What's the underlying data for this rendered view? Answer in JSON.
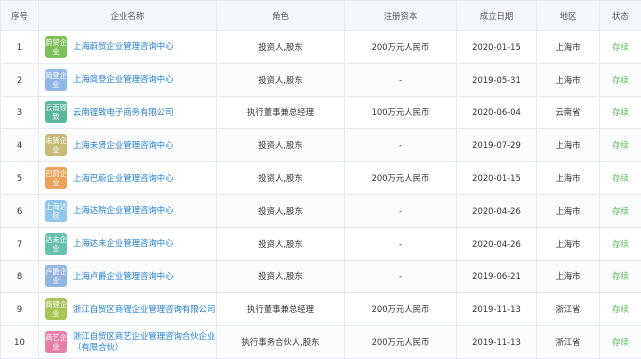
{
  "headers": [
    "序号",
    "企业名称",
    "角色",
    "注册资本",
    "成立日期",
    "地区",
    "状态"
  ],
  "rows": [
    {
      "no": "1",
      "logo_text": "蔚贸企业",
      "logo_color": "#7cc05a",
      "name": "上海蔚贸企业管理咨询中心",
      "role": "投资人,股东",
      "capital": "200万元人民币",
      "date": "2020-01-15",
      "region": "上海市",
      "status": "存续"
    },
    {
      "no": "2",
      "logo_text": "简登企业",
      "logo_color": "#8fb8e6",
      "name": "上海简登企业管理咨询中心",
      "role": "投资人,股东",
      "capital": "-",
      "date": "2019-05-31",
      "region": "上海市",
      "status": "存续"
    },
    {
      "no": "3",
      "logo_text": "云南铿致",
      "logo_color": "#57b69b",
      "name": "云南铿致电子商务有限公司",
      "role": "执行董事兼总经理",
      "capital": "100万元人民币",
      "date": "2020-06-04",
      "region": "云南省",
      "status": "存续"
    },
    {
      "no": "4",
      "logo_text": "未贤企业",
      "logo_color": "#c8bb7a",
      "name": "上海未贤企业管理咨询中心",
      "role": "投资人,股东",
      "capital": "-",
      "date": "2019-07-29",
      "region": "上海市",
      "status": "存续"
    },
    {
      "no": "5",
      "logo_text": "巴蔚企业",
      "logo_color": "#e9a35c",
      "name": "上海巴蔚企业管理咨询中心",
      "role": "投资人,股东",
      "capital": "200万元人民币",
      "date": "2020-01-15",
      "region": "上海市",
      "status": "存续"
    },
    {
      "no": "6",
      "logo_text": "上海达院",
      "logo_color": "#8fc7ea",
      "name": "上海达院企业管理咨询中心",
      "role": "投资人,股东",
      "capital": "-",
      "date": "2020-04-26",
      "region": "上海市",
      "status": "存续"
    },
    {
      "no": "7",
      "logo_text": "达未企业",
      "logo_color": "#67bfae",
      "name": "上海达未企业管理咨询中心",
      "role": "投资人,股东",
      "capital": "-",
      "date": "2020-04-26",
      "region": "上海市",
      "status": "存续"
    },
    {
      "no": "8",
      "logo_text": "卢爵企业",
      "logo_color": "#93b5e0",
      "name": "上海卢爵企业管理咨询中心",
      "role": "投资人,股东",
      "capital": "-",
      "date": "2019-06-21",
      "region": "上海市",
      "status": "存续"
    },
    {
      "no": "9",
      "logo_text": "商锂企业",
      "logo_color": "#a8c457",
      "name": "浙江自贸区商锂企业管理咨询有限公司",
      "role": "执行董事兼总经理",
      "capital": "200万元人民币",
      "date": "2019-11-13",
      "region": "浙江省",
      "status": "存续"
    },
    {
      "no": "10",
      "logo_text": "商艺企业",
      "logo_color": "#e57fa8",
      "name": "浙江自贸区商艺企业管理咨询合伙企业（有限合伙）",
      "role": "执行事务合伙人,股东",
      "capital": "200万元人民币",
      "date": "2019-11-13",
      "region": "浙江省",
      "status": "存续"
    }
  ]
}
